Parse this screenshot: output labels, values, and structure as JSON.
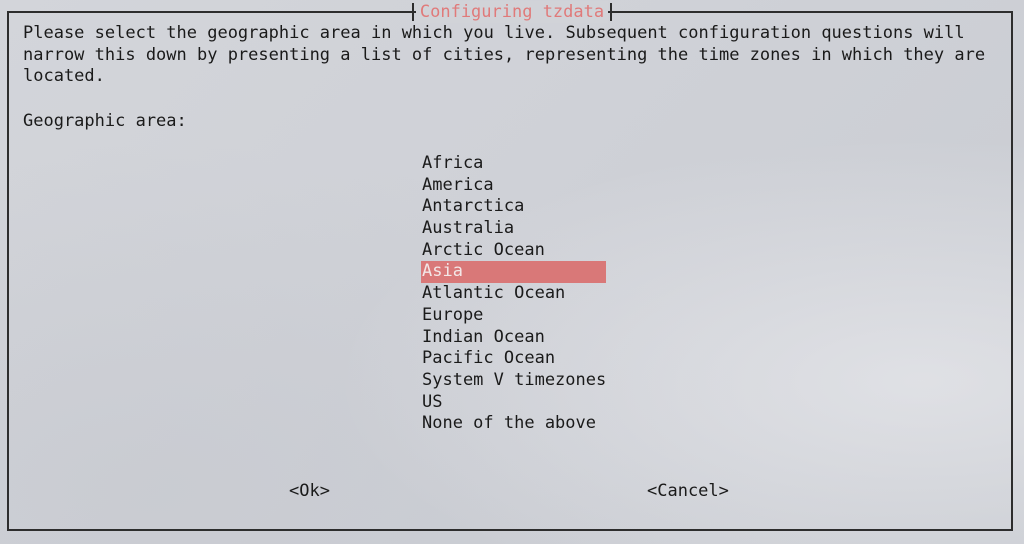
{
  "dialog": {
    "title": "Configuring tzdata",
    "description": "Please select the geographic area in which you live. Subsequent configuration questions will\nnarrow this down by presenting a list of cities, representing the time zones in which they are\nlocated.",
    "prompt_label": "Geographic area:",
    "areas": [
      "Africa",
      "America",
      "Antarctica",
      "Australia",
      "Arctic Ocean",
      "Asia",
      "Atlantic Ocean",
      "Europe",
      "Indian Ocean",
      "Pacific Ocean",
      "System V timezones",
      "US",
      "None of the above"
    ],
    "selected_index": 5,
    "ok_label": "<Ok>",
    "cancel_label": "<Cancel>"
  },
  "colors": {
    "title": "#e07a7a",
    "selection": "#d97878",
    "selection_text": "#f3e7e7",
    "border": "#2d2d2d",
    "text": "#1a1a1a"
  }
}
